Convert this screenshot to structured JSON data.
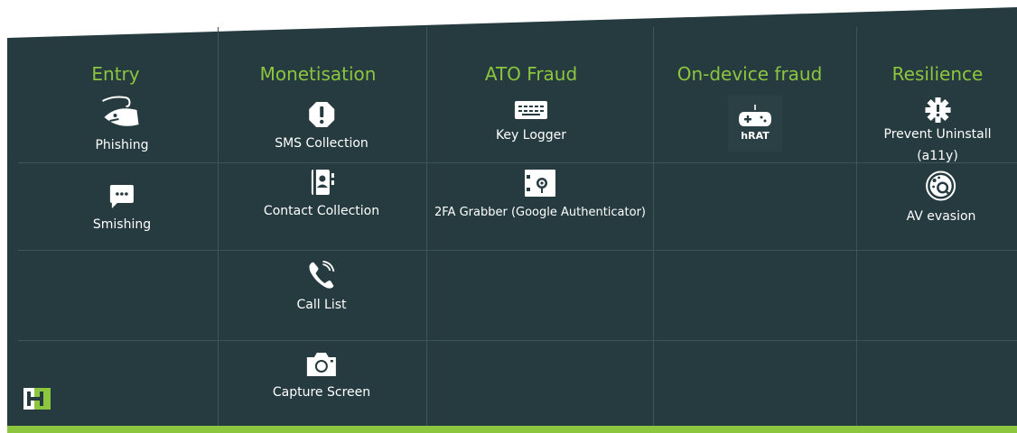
{
  "colors": {
    "background": "#263b40",
    "heading": "#8cc63f",
    "text": "#ffffff",
    "accent_bar": "#8cc63f"
  },
  "columns": [
    {
      "heading": "Entry"
    },
    {
      "heading": "Monetisation"
    },
    {
      "heading": "ATO Fraud"
    },
    {
      "heading": "On-device fraud"
    },
    {
      "heading": "Resilience"
    }
  ],
  "items": {
    "phishing": {
      "label": "Phishing",
      "icon": "fish-hook-icon"
    },
    "smishing": {
      "label": "Smishing",
      "icon": "chat-bubble-icon"
    },
    "sms_collection": {
      "label": "SMS Collection",
      "icon": "alert-shield-icon"
    },
    "contact_collection": {
      "label": "Contact Collection",
      "icon": "contact-book-icon"
    },
    "call_list": {
      "label": "Call List",
      "icon": "phone-icon"
    },
    "capture_screen": {
      "label": "Capture Screen",
      "icon": "camera-icon"
    },
    "key_logger": {
      "label": "Key Logger",
      "icon": "keyboard-icon"
    },
    "twofa_grabber": {
      "label": "2FA Grabber (Google Authenticator)",
      "icon": "safe-icon"
    },
    "hrat": {
      "label": "hRAT",
      "icon": "gamepad-icon"
    },
    "prevent_uninstall": {
      "label_line1": "Prevent Uninstall",
      "label_line2": "(a11y)",
      "icon": "gear-icon"
    },
    "av_evasion": {
      "label": "AV evasion",
      "icon": "virus-search-icon"
    }
  }
}
